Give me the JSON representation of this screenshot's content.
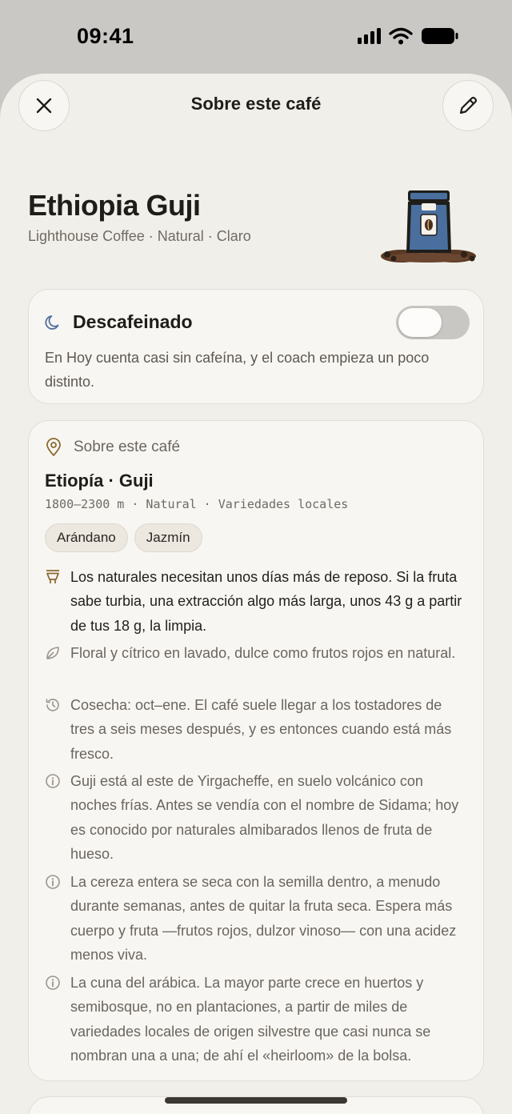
{
  "status_bar": {
    "time": "09:41"
  },
  "header": {
    "title": "Sobre este café"
  },
  "coffee": {
    "name": "Ethiopia Guji",
    "meta": "Lighthouse Coffee · Natural · Claro"
  },
  "decaf": {
    "title": "Descafeinado",
    "description": "En Hoy cuenta casi sin cafeína, y el coach empieza un poco distinto.",
    "enabled": false
  },
  "about": {
    "header": "Sobre este café",
    "origin": "Etiopía · Guji",
    "specs": "1800–2300 m · Natural · Variedades locales",
    "tags": [
      "Arándano",
      "Jazmín"
    ],
    "notes": [
      {
        "icon": "dripper-icon",
        "text": "Los naturales necesitan unos días más de reposo. Si la fruta sabe turbia, una extracción algo más larga, unos 43 g a partir de tus 18 g, la limpia."
      },
      {
        "icon": "leaf-icon",
        "text": "Floral y cítrico en lavado, dulce como frutos rojos en natural."
      },
      {
        "icon": "history-icon",
        "text": "Cosecha: oct–ene. El café suele llegar a los tostadores de tres a seis meses después, y es entonces cuando está más fresco."
      },
      {
        "icon": "info-icon",
        "text": "Guji está al este de Yirgacheffe, en suelo volcánico con noches frías. Antes se vendía con el nombre de Sidama; hoy es conocido por naturales almibarados llenos de fruta de hueso."
      },
      {
        "icon": "info-icon",
        "text": "La cereza entera se seca con la semilla dentro, a menudo durante semanas, antes de quitar la fruta seca. Espera más cuerpo y fruta —frutos rojos, dulzor vinoso— con una acidez menos viva."
      },
      {
        "icon": "info-icon",
        "text": "La cuna del arábica. La mayor parte crece en huertos y semibosque, no en plantaciones, a partir de miles de variedades locales de origen silvestre que casi nunca se nombran una a una; de ahí el «heirloom» de la bolsa."
      }
    ]
  },
  "colors": {
    "sheet_bg": "#f1efea",
    "card_bg": "#f8f6f2",
    "accent_bag": "#4a6f9e",
    "muted_text": "#6a655e"
  }
}
